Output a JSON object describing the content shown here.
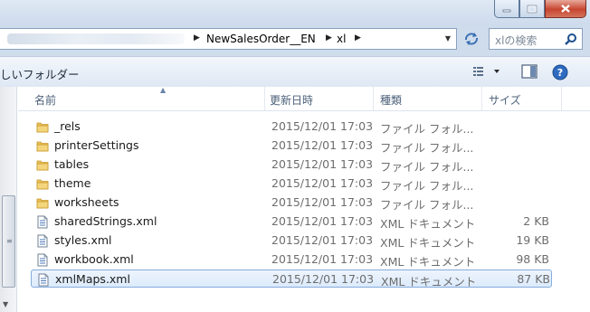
{
  "address": {
    "crumbs": [
      "NewSalesOrder__EN",
      "xl"
    ],
    "separator": "▶"
  },
  "search": {
    "placeholder": "xlの検索"
  },
  "toolbar": {
    "new_folder": "しいフォルダー"
  },
  "columns": {
    "name": "名前",
    "date": "更新日時",
    "type": "種類",
    "size": "サイズ"
  },
  "files": [
    {
      "name": "_rels",
      "date": "2015/12/01 17:03",
      "type": "ファイル フォル...",
      "size": "",
      "icon": "folder-icon"
    },
    {
      "name": "printerSettings",
      "date": "2015/12/01 17:03",
      "type": "ファイル フォル...",
      "size": "",
      "icon": "folder-icon"
    },
    {
      "name": "tables",
      "date": "2015/12/01 17:03",
      "type": "ファイル フォル...",
      "size": "",
      "icon": "folder-icon"
    },
    {
      "name": "theme",
      "date": "2015/12/01 17:03",
      "type": "ファイル フォル...",
      "size": "",
      "icon": "folder-icon"
    },
    {
      "name": "worksheets",
      "date": "2015/12/01 17:03",
      "type": "ファイル フォル...",
      "size": "",
      "icon": "folder-icon"
    },
    {
      "name": "sharedStrings.xml",
      "date": "2015/12/01 17:03",
      "type": "XML ドキュメント",
      "size": "2 KB",
      "icon": "xml-file-icon"
    },
    {
      "name": "styles.xml",
      "date": "2015/12/01 17:03",
      "type": "XML ドキュメント",
      "size": "19 KB",
      "icon": "xml-file-icon"
    },
    {
      "name": "workbook.xml",
      "date": "2015/12/01 17:03",
      "type": "XML ドキュメント",
      "size": "98 KB",
      "icon": "xml-file-icon"
    },
    {
      "name": "xmlMaps.xml",
      "date": "2015/12/01 17:03",
      "type": "XML ドキュメント",
      "size": "87 KB",
      "icon": "xml-file-icon",
      "selected": true
    }
  ],
  "colors": {
    "accent": "#84acdd",
    "folder": "#e8c15a",
    "close": "#c7452f"
  }
}
